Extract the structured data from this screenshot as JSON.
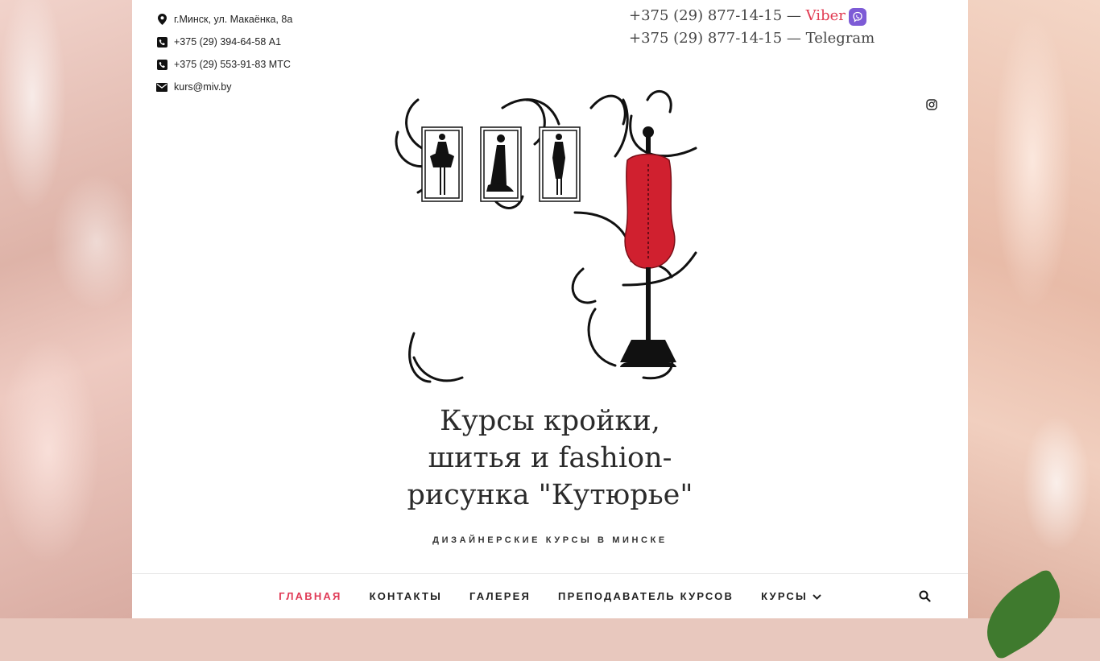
{
  "contacts": {
    "address": "г.Минск, ул. Макаёнка, 8а",
    "phone_a1": "+375 (29) 394-64-58 А1",
    "phone_mts": "+375 (29) 553-91-83 МТС",
    "email": "kurs@miv.by"
  },
  "messengers": {
    "phone": "+375 (29) 877-14-15",
    "dash": " — ",
    "viber": "Viber",
    "telegram": "Telegram"
  },
  "site": {
    "title_line1": "Курсы кройки,",
    "title_line2": "шитья и fashion-",
    "title_line3": "рисунка \"Кутюрье\"",
    "tagline": "ДИЗАЙНЕРСКИЕ КУРСЫ В МИНСКЕ"
  },
  "nav": {
    "items": [
      {
        "label": "ГЛАВНАЯ"
      },
      {
        "label": "КОНТАКТЫ"
      },
      {
        "label": "ГАЛЕРЕЯ"
      },
      {
        "label": "ПРЕПОДАВАТЕЛЬ КУРСОВ"
      },
      {
        "label": "КУРСЫ"
      }
    ]
  },
  "icons": [
    "map-pin-icon",
    "phone-icon",
    "email-icon",
    "viber-icon",
    "instagram-icon",
    "chevron-down-icon",
    "search-icon"
  ],
  "colors": {
    "accent": "#e03a56",
    "viber": "#7d5bd6",
    "mannequin": "#d0202f"
  }
}
